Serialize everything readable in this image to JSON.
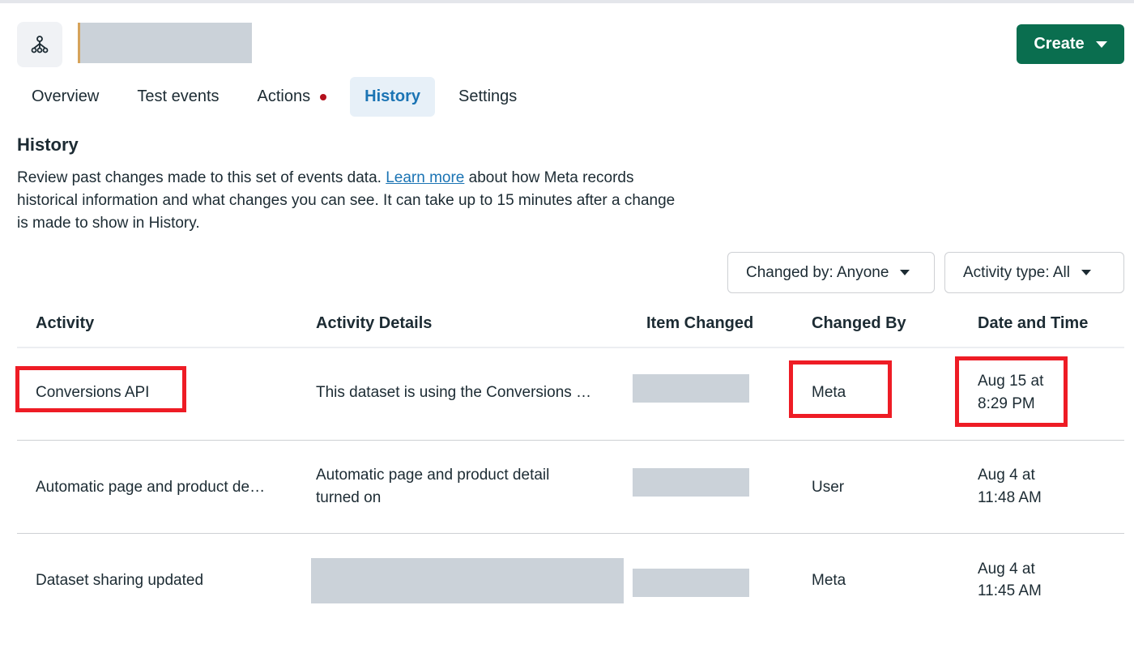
{
  "header": {
    "dataset_icon": "dataset-network-icon",
    "create_label": "Create"
  },
  "tabs": [
    {
      "label": "Overview",
      "active": false
    },
    {
      "label": "Test events",
      "active": false
    },
    {
      "label": "Actions",
      "active": false,
      "has_dot": true
    },
    {
      "label": "History",
      "active": true
    },
    {
      "label": "Settings",
      "active": false
    }
  ],
  "section": {
    "title": "History",
    "desc_before": "Review past changes made to this set of events data. ",
    "link": "Learn more",
    "desc_after": " about how Meta records historical information and what changes you can see. It can take up to 15 minutes after a change is made to show in History."
  },
  "filters": {
    "changed_by": "Changed by: Anyone",
    "activity_type": "Activity type: All"
  },
  "table": {
    "columns": [
      "Activity",
      "Activity Details",
      "Item Changed",
      "Changed By",
      "Date and Time"
    ],
    "rows": [
      {
        "activity": "Conversions API",
        "details": "This dataset is using the Conversions …",
        "changed_by": "Meta",
        "date": "Aug 15 at",
        "time": "8:29 PM"
      },
      {
        "activity": "Automatic page and product de…",
        "details_line1": "Automatic page and product detail",
        "details_line2": "turned on",
        "changed_by": "User",
        "date": "Aug 4 at",
        "time": "11:48 AM"
      },
      {
        "activity": "Dataset sharing updated",
        "changed_by": "Meta",
        "date": "Aug 4 at",
        "time": "11:45 AM"
      }
    ]
  },
  "colors": {
    "accent": "#0a6e4f",
    "active_tab_text": "#1b74b4",
    "active_tab_bg": "#e7f0f8",
    "highlight": "#ee1c25",
    "redaction": "#cbd2d9"
  }
}
